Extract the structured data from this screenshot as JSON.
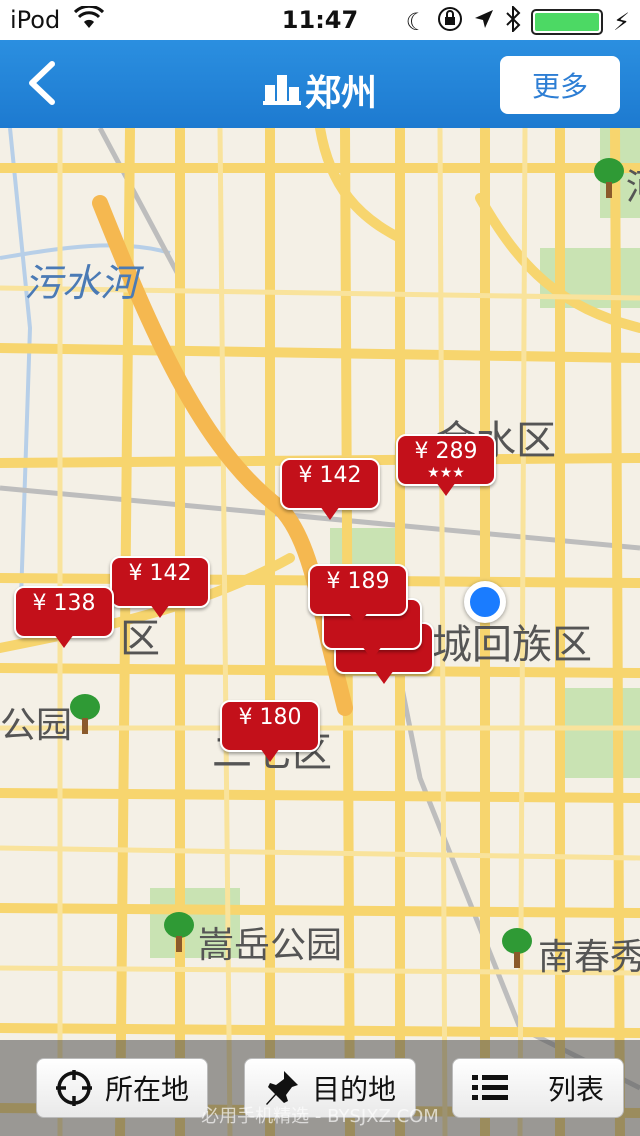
{
  "status_bar": {
    "carrier": "iPod",
    "time": "11:47"
  },
  "navbar": {
    "title": "郑州",
    "more_label": "更多"
  },
  "map": {
    "labels": {
      "river": "污水河",
      "district_jinshui": "金水区",
      "district_guancheng": "城回族区",
      "district_left": "区",
      "district_erqi": "二七区",
      "park_left": "公园",
      "park_songyue": "嵩岳公园",
      "park_nanchun": "南春秀",
      "corner_top_right": "河"
    },
    "pins": [
      {
        "price": "¥ 289",
        "stars": "★★★"
      },
      {
        "price": "¥ 142",
        "stars": ""
      },
      {
        "price": "¥ 142",
        "stars": ""
      },
      {
        "price": "¥ 138",
        "stars": ""
      },
      {
        "price": "¥ 189",
        "stars": ""
      },
      {
        "price": "¥ 180",
        "stars": ""
      },
      {
        "price": "",
        "stars": "★★★"
      },
      {
        "price": "",
        "stars": ""
      }
    ],
    "colors": {
      "pin": "#c3101a",
      "location_dot": "#1a7cff",
      "road": "#f7d56e",
      "highway": "#f5b850",
      "park": "#c9e3b3"
    }
  },
  "toolbar": {
    "current_location_label": "所在地",
    "destination_label": "目的地",
    "list_label": "列表"
  },
  "watermark": "必用手机精选 - BYSJXZ.COM"
}
